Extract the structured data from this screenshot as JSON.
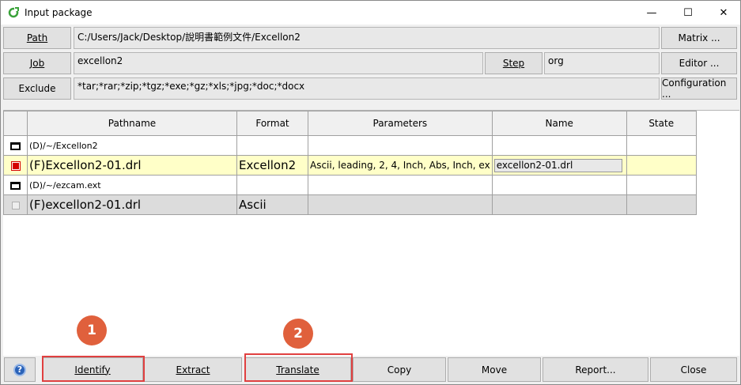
{
  "window": {
    "title": "Input package",
    "minimize_glyph": "—",
    "maximize_glyph": "☐",
    "close_glyph": "✕"
  },
  "toolbar": {
    "path_label": "Path",
    "path_value": "C:/Users/Jack/Desktop/說明書範例文件/Excellon2",
    "job_label": "Job",
    "job_value": "excellon2",
    "step_label": "Step",
    "step_value": "org",
    "exclude_label": "Exclude",
    "exclude_value": "*tar;*rar;*zip;*tgz;*exe;*gz;*xls;*jpg;*doc;*docx",
    "matrix_label": "Matrix ...",
    "editor_label": "Editor ...",
    "configuration_label": "Configuration ..."
  },
  "table": {
    "headers": [
      "Pathname",
      "Format",
      "Parameters",
      "Name",
      "State"
    ],
    "rows": [
      {
        "type": "dir",
        "pathname": "(D)/~/Excellon2",
        "format": "",
        "parameters": "",
        "name": "",
        "state": ""
      },
      {
        "type": "file-selected",
        "checked": true,
        "pathname": "(F)Excellon2-01.drl",
        "format": "Excellon2",
        "parameters": "Ascii, leading, 2, 4, Inch, Abs, Inch, ex",
        "name": "excellon2-01.drl",
        "state": ""
      },
      {
        "type": "dir",
        "pathname": "(D)/~/ezcam.ext",
        "format": "",
        "parameters": "",
        "name": "",
        "state": ""
      },
      {
        "type": "file-gray",
        "checked": false,
        "pathname": "(F)excellon2-01.drl",
        "format": "Ascii",
        "parameters": "",
        "name": "",
        "state": ""
      }
    ]
  },
  "bottom": {
    "help_glyph": "?",
    "identify_label": "Identify",
    "extract_label": "Extract",
    "translate_label": "Translate",
    "copy_label": "Copy",
    "move_label": "Move",
    "report_label": "Report...",
    "close_label": "Close"
  },
  "annotations": {
    "badge1": "1",
    "badge2": "2",
    "highlight_color": "#e04040",
    "badge_color": "#e0603c"
  }
}
